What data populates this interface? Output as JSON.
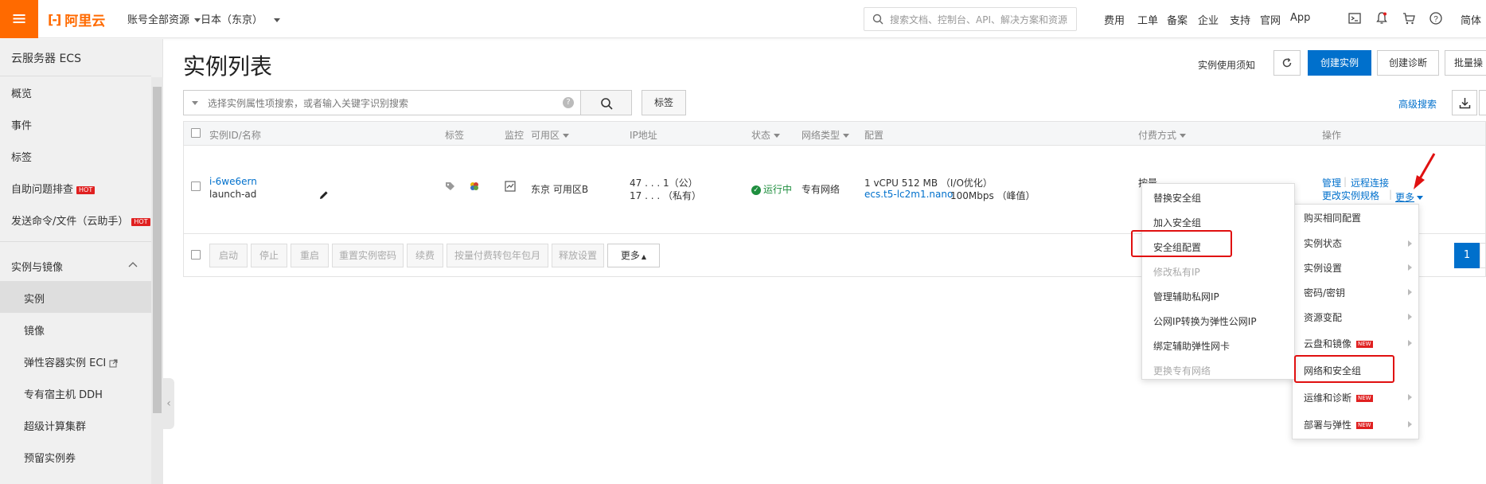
{
  "topbar": {
    "logo_text": "阿里云",
    "account": "账号全部资源",
    "region": "日本（东京）",
    "search_placeholder": "搜索文档、控制台、API、解决方案和资源",
    "nav": [
      "费用",
      "工单",
      "备案",
      "企业",
      "支持",
      "官网",
      "App"
    ],
    "lang": "简体"
  },
  "sidebar": {
    "title": "云服务器 ECS",
    "items": [
      "概览",
      "事件",
      "标签",
      "自助问题排查",
      "发送命令/文件（云助手）"
    ],
    "hot_label": "HOT",
    "group": "实例与镜像",
    "sub_items": [
      "实例",
      "镜像",
      "弹性容器实例 ECI",
      "专有宿主机 DDH",
      "超级计算集群",
      "预留实例券"
    ]
  },
  "page": {
    "title": "实例列表",
    "notice_link": "实例使用须知",
    "create_instance": "创建实例",
    "create_diag": "创建诊断",
    "batch_op": "批量操",
    "filter_placeholder": "选择实例属性项搜索，或者输入关键字识别搜索",
    "tag_button": "标签",
    "advanced_search": "高级搜索"
  },
  "table": {
    "headers": [
      "实例ID/名称",
      "标签",
      "监控",
      "可用区",
      "IP地址",
      "状态",
      "网络类型",
      "配置",
      "付费方式",
      "操作"
    ],
    "row": {
      "instance_id": "i-6we6ern",
      "instance_name": "launch-ad",
      "zone": "东京 可用区B",
      "ip_public": "47 . . . 1（公）",
      "ip_private": "17 . . . （私有）",
      "status": "运行中",
      "network": "专有网络",
      "config_line1": "1 vCPU 512 MB （I/O优化）",
      "config_type": "ecs.t5-lc2m1.nano",
      "config_bw": "100Mbps （峰值）",
      "billing": "按量",
      "op_manage": "管理",
      "op_remote": "远程连接",
      "op_change": "更改实例规格",
      "op_more": "更多"
    },
    "footer_buttons": [
      "启动",
      "停止",
      "重启",
      "重置实例密码",
      "续费",
      "按量付费转包年包月",
      "释放设置"
    ],
    "footer_more": "更多",
    "page_current": "1"
  },
  "more_menu": {
    "items": [
      "购买相同配置",
      "实例状态",
      "实例设置",
      "密码/密钥",
      "资源变配",
      "云盘和镜像",
      "网络和安全组",
      "运维和诊断",
      "部署与弹性"
    ],
    "new_label": "NEW"
  },
  "sub_menu": {
    "items": [
      "替换安全组",
      "加入安全组",
      "安全组配置",
      "修改私有IP",
      "管理辅助私网IP",
      "公网IP转换为弹性公网IP",
      "绑定辅助弹性网卡",
      "更换专有网络"
    ]
  },
  "colors": {
    "brand": "#ff6a00",
    "primary": "#0070cc",
    "highlight": "#e01010",
    "status_green": "#1e8e3e"
  }
}
